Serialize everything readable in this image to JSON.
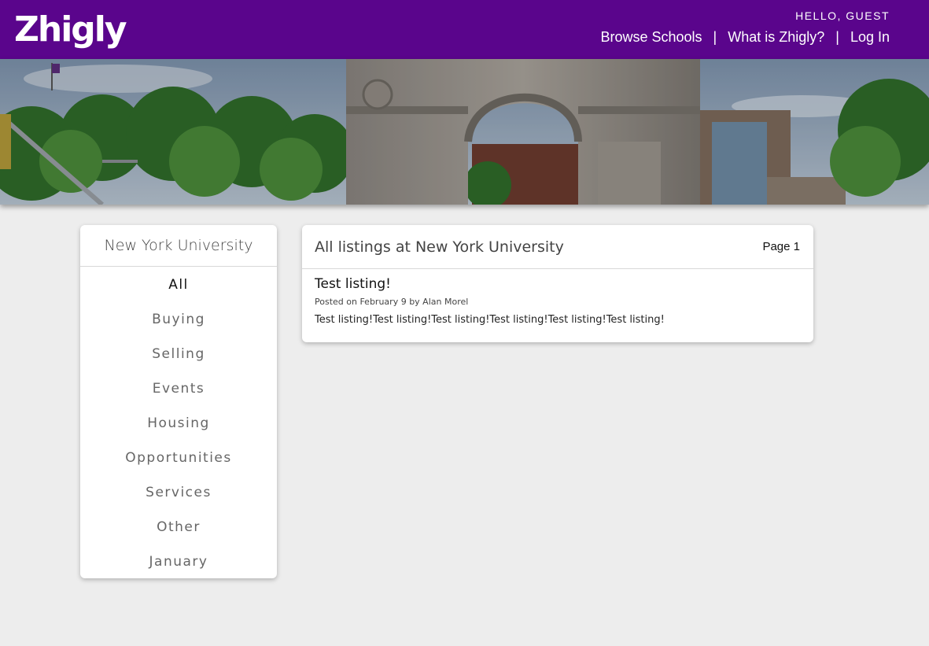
{
  "header": {
    "logo": "Zhigly",
    "greeting": "HELLO, GUEST",
    "nav": {
      "browse": "Browse Schools",
      "separator": "|",
      "about": "What is Zhigly?",
      "login": "Log In"
    },
    "accent_color": "#5a058c"
  },
  "hero": {
    "image": "photo of Washington Square Arch with trees and buildings"
  },
  "sidebar": {
    "school_name": "New York University",
    "categories": [
      {
        "label": "All",
        "active": true
      },
      {
        "label": "Buying",
        "active": false
      },
      {
        "label": "Selling",
        "active": false
      },
      {
        "label": "Events",
        "active": false
      },
      {
        "label": "Housing",
        "active": false
      },
      {
        "label": "Opportunities",
        "active": false
      },
      {
        "label": "Services",
        "active": false
      },
      {
        "label": "Other",
        "active": false
      },
      {
        "label": "January",
        "active": false
      }
    ]
  },
  "main": {
    "title": "All listings at New York University",
    "page_label": "Page 1",
    "listings": [
      {
        "title": "Test listing!",
        "meta": "Posted on February 9 by Alan Morel",
        "body": "Test listing!Test listing!Test listing!Test listing!Test listing!Test listing!"
      }
    ]
  }
}
